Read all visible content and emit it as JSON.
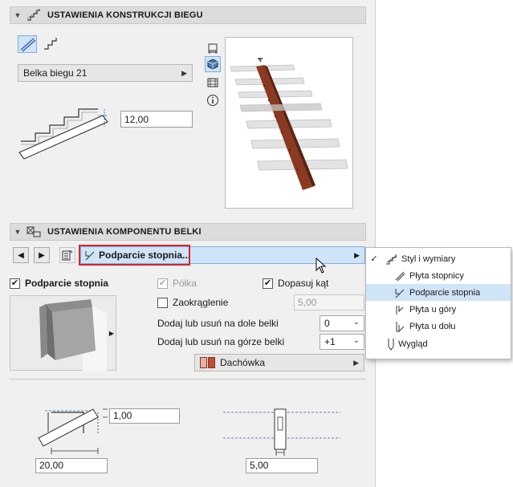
{
  "stair_section": {
    "title": "USTAWIENIA KONSTRUKCJI BIEGU",
    "structure_select": "Belka biegu 21",
    "thickness_value": "12,00"
  },
  "beam_section": {
    "title": "USTAWIENIA KOMPONENTU BELKI",
    "component_button": "Podparcie stopnia...",
    "support_checkbox": {
      "label": "Podparcie stopnia",
      "checked": true
    },
    "shelf_checkbox": {
      "label": "Półka",
      "checked": true,
      "disabled": true
    },
    "fit_angle_checkbox": {
      "label": "Dopasuj kąt",
      "checked": true
    },
    "rounding_checkbox": {
      "label": "Zaokrąglenie",
      "checked": false
    },
    "rounding_value": "5,00",
    "add_bottom_label": "Dodaj lub usuń na dole belki",
    "add_bottom_value": "0",
    "add_top_label": "Dodaj lub usuń na górze belki",
    "add_top_value": "+1",
    "material": "Dachówka",
    "dim_height": "1,00",
    "dim_width": "20,00",
    "dim_thickness": "5,00"
  },
  "popup_menu": {
    "items": [
      {
        "label": "Styl i wymiary",
        "icon": "style-icon",
        "checked": true,
        "highlighted": false
      },
      {
        "label": "Płyta stopnicy",
        "icon": "tread-plate-icon",
        "checked": false,
        "highlighted": false
      },
      {
        "label": "Podparcie stopnia",
        "icon": "tread-support-icon",
        "checked": false,
        "highlighted": true
      },
      {
        "label": "Płyta u góry",
        "icon": "top-plate-icon",
        "checked": false,
        "highlighted": false
      },
      {
        "label": "Płyta u dołu",
        "icon": "bottom-plate-icon",
        "checked": false,
        "highlighted": false
      },
      {
        "label": "Wygląd",
        "icon": "appearance-icon",
        "checked": false,
        "highlighted": false
      }
    ]
  },
  "colors": {
    "accent": "#cfe4f7",
    "highlight_border": "#e0222a",
    "beam": "#8a3a20"
  }
}
